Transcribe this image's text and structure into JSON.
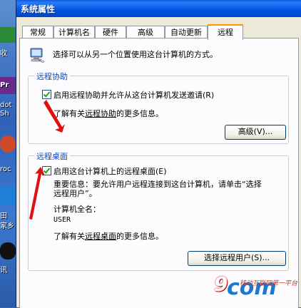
{
  "window": {
    "title": "系统属性"
  },
  "desktop": {
    "fragments": [
      "收",
      "Pr",
      "dot",
      "Sh",
      "roc",
      "田",
      "家乡",
      "讯"
    ]
  },
  "tabs": [
    "常规",
    "计算机名",
    "硬件",
    "高级",
    "自动更新",
    "远程"
  ],
  "intro": "选择可以从另一个位置使用这台计算机的方式。",
  "remote_assistance": {
    "legend": "远程协助",
    "checkbox_label": "启用远程协助并允许从这台计算机发送邀请(R)",
    "checked": true,
    "info_prefix": "了解有关",
    "info_link": "远程协助",
    "info_suffix": "的更多信息。",
    "advanced_button": "高级(V)..."
  },
  "remote_desktop": {
    "legend": "远程桌面",
    "checkbox_label": "启用这台计算机上的远程桌面(E)",
    "checked": true,
    "note_line1": "重要信息：要允许用户远程连接到这台计算机，请单击“选择",
    "note_line2": "远程用户”。",
    "computer_name_label": "计算机全名：",
    "computer_name_value": "USER",
    "info_prefix": "了解有关",
    "info_link": "远程桌面",
    "info_suffix": "的更多信息。",
    "select_users_button": "选择远程用户(S)..."
  },
  "watermark": {
    "num": "9",
    "com": "com",
    "slogan": "移动互联网第一平台"
  }
}
